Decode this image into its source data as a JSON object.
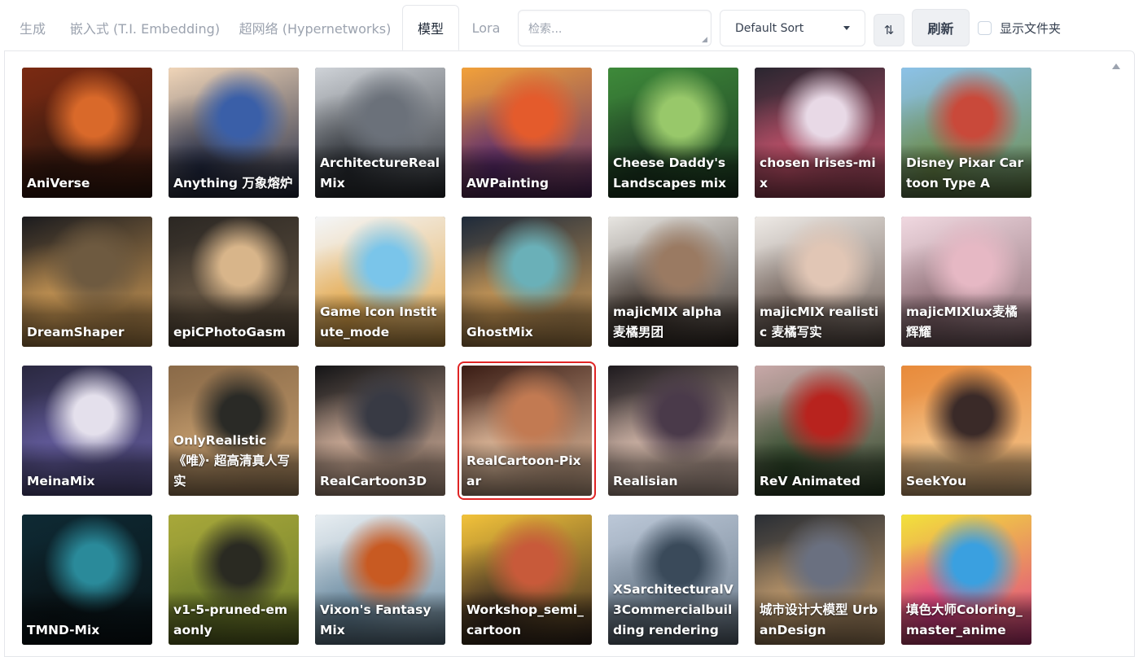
{
  "tabs": [
    {
      "label": "生成"
    },
    {
      "label": "嵌入式 (T.I. Embedding)"
    },
    {
      "label": "超网络 (Hypernetworks)"
    },
    {
      "label": "模型"
    },
    {
      "label": "Lora"
    }
  ],
  "active_tab": "模型",
  "search": {
    "placeholder": "检索...",
    "value": ""
  },
  "sort": {
    "selected": "Default Sort"
  },
  "sort_direction_icon": "⇅",
  "refresh_label": "刷新",
  "show_folders": {
    "label": "显示文件夹",
    "checked": false
  },
  "selected_model": "RealCartoon-Pixar",
  "models": [
    {
      "name": "AniVerse",
      "colors": [
        "#7a2a12",
        "#d9692a",
        "#3a1a10"
      ]
    },
    {
      "name": "Anything 万象熔炉",
      "colors": [
        "#f0d5b8",
        "#3a5fa8",
        "#222a44"
      ]
    },
    {
      "name": "ArchitectureRealMix",
      "colors": [
        "#cfd3d8",
        "#6b717a",
        "#2b2f35"
      ]
    },
    {
      "name": "AWPainting",
      "colors": [
        "#f2a13a",
        "#e45b2c",
        "#5a2a6e"
      ]
    },
    {
      "name": "Cheese Daddy's Landscapes mix",
      "colors": [
        "#3e8a3a",
        "#98c86a",
        "#1c3a22"
      ]
    },
    {
      "name": "chosen Irises-mix",
      "colors": [
        "#2a2630",
        "#e8d9e6",
        "#c9546e"
      ]
    },
    {
      "name": "Disney Pixar Cartoon Type A",
      "colors": [
        "#8cc2e8",
        "#c9493a",
        "#6b8a4a"
      ]
    },
    {
      "name": "DreamShaper",
      "colors": [
        "#1b1b1e",
        "#6e5a40",
        "#d9a35a"
      ]
    },
    {
      "name": "epiCPhotoGasm",
      "colors": [
        "#2b2723",
        "#d8b58a",
        "#6b5a46"
      ]
    },
    {
      "name": "Game Icon Institute_mode",
      "colors": [
        "#f4f6f8",
        "#7ac5ea",
        "#e3a74a"
      ]
    },
    {
      "name": "GhostMix",
      "colors": [
        "#1e2a3a",
        "#6ab0b8",
        "#d9a35a"
      ]
    },
    {
      "name": "majicMIX alpha 麦橘男团",
      "colors": [
        "#e8e6e2",
        "#9a7a62",
        "#3a2f28"
      ]
    },
    {
      "name": "majicMIX realistic 麦橘写实",
      "colors": [
        "#eeeae6",
        "#e1c6b5",
        "#6a5a52"
      ]
    },
    {
      "name": "majicMIXlux麦橘辉耀",
      "colors": [
        "#f0d8e0",
        "#e6b8c4",
        "#8a6a72"
      ]
    },
    {
      "name": "MeinaMix",
      "colors": [
        "#2a2840",
        "#e4e0ec",
        "#6a62a8"
      ]
    },
    {
      "name": "OnlyRealistic 《唯》· 超高清真人写实",
      "colors": [
        "#8a6a48",
        "#2a2a26",
        "#c8a070"
      ]
    },
    {
      "name": "RealCartoon3D",
      "colors": [
        "#141416",
        "#383a44",
        "#e4bfa8"
      ]
    },
    {
      "name": "RealCartoon-Pixar",
      "colors": [
        "#3a1c14",
        "#c27a52",
        "#f0c9a8"
      ]
    },
    {
      "name": "Realisian",
      "colors": [
        "#1e1a1e",
        "#4a3a4a",
        "#e6c8b8"
      ]
    },
    {
      "name": "ReV Animated",
      "colors": [
        "#c8a8a8",
        "#b8231e",
        "#2f4a2a"
      ]
    },
    {
      "name": "SeekYou",
      "colors": [
        "#e88a3a",
        "#3a2a28",
        "#f4c890"
      ]
    },
    {
      "name": "TMND-Mix",
      "colors": [
        "#0e2a34",
        "#2a8a9a",
        "#0a1418"
      ]
    },
    {
      "name": "v1-5-pruned-emaonly",
      "colors": [
        "#a8a83a",
        "#2a2a22",
        "#6a7a2a"
      ]
    },
    {
      "name": "Vixon's Fantasy Mix",
      "colors": [
        "#e8eef2",
        "#c85a22",
        "#6a8aa0"
      ]
    },
    {
      "name": "Workshop_semi_cartoon",
      "colors": [
        "#f2c23a",
        "#c85a3a",
        "#3a2a22"
      ]
    },
    {
      "name": "XSarchitecturalV3Commercialbuilding rendering",
      "colors": [
        "#bcc8d8",
        "#3a4a5a",
        "#6a7a8a"
      ]
    },
    {
      "name": "城市设计大模型 UrbanDesign",
      "colors": [
        "#2a2e34",
        "#6a7080",
        "#c8a070"
      ]
    },
    {
      "name": "填色大师Coloring_master_anime",
      "colors": [
        "#f2e23a",
        "#3aa0e0",
        "#e03a8a"
      ]
    }
  ]
}
